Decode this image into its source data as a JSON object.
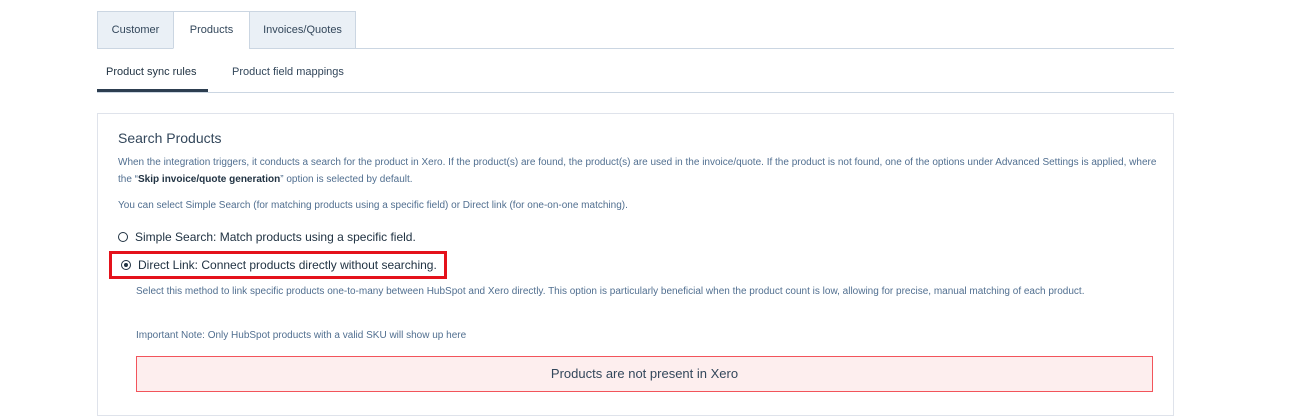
{
  "tabs": {
    "customer": "Customer",
    "products": "Products",
    "invoices": "Invoices/Quotes"
  },
  "subtabs": {
    "sync_rules": "Product sync rules",
    "field_mappings": "Product field mappings"
  },
  "panel": {
    "title": "Search Products",
    "desc_part1": "When the integration triggers, it conducts a search for the product in Xero. If the product(s) are found, the product(s) are used in the invoice/quote. If the product is not found, one of the options under Advanced Settings is applied, where the “",
    "desc_bold": "Skip invoice/quote generation",
    "desc_part2": "” option is selected by default.",
    "desc2": "You can select Simple Search (for matching products using a specific field) or Direct link (for one-on-one matching).",
    "simple_label": "Simple Search: Match products using a specific field.",
    "direct_label": "Direct Link: Connect products directly without searching.",
    "direct_desc": "Select this method to link specific products one-to-many between HubSpot and Xero directly. This option is particularly beneficial when the product count is low, allowing for precise, manual matching of each product.",
    "note": "Important Note: Only HubSpot products with a valid SKU will show up here",
    "alert": "Products are not present in Xero"
  },
  "state": {
    "selected_option": "direct_link"
  },
  "colors": {
    "highlight_border": "#e4121b",
    "alert_border": "#f2545b",
    "alert_bg": "#fdeeee"
  }
}
